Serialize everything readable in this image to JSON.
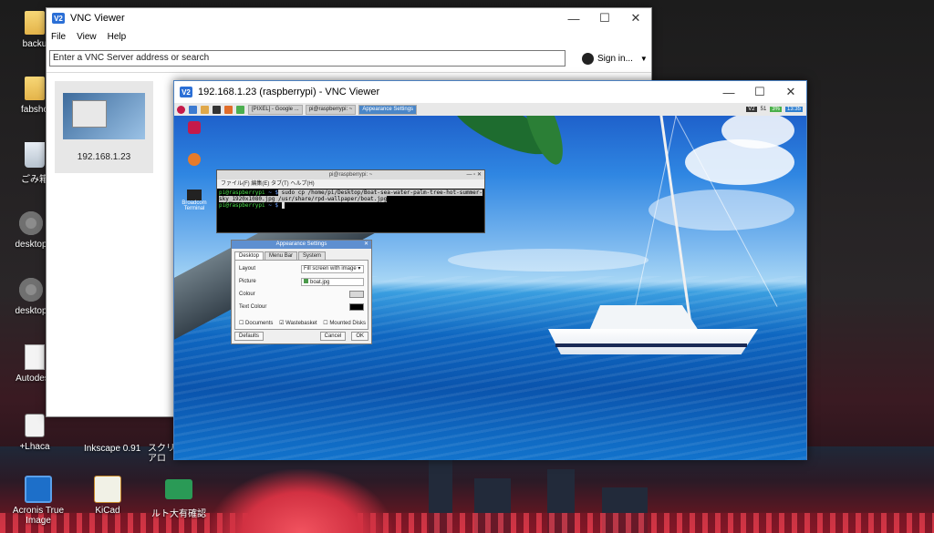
{
  "desktop": {
    "left_icons": [
      {
        "label": "backu",
        "icon": "folder-icon"
      },
      {
        "label": "fabsho",
        "icon": "folder-icon"
      },
      {
        "label": "ごみ箱",
        "icon": "recycle-bin-icon"
      },
      {
        "label": "desktop",
        "icon": "settings-icon"
      },
      {
        "label": "desktop",
        "icon": "settings-icon"
      },
      {
        "label": "Autodesk",
        "icon": "document-icon"
      },
      {
        "label": "+Lhaca",
        "icon": "archive-app-icon"
      }
    ],
    "bottom_icons": [
      {
        "label": "Inkscape 0.91"
      },
      {
        "label": "スクリ アロ"
      },
      {
        "label": "Acronis True Image",
        "icon": "acronis-icon"
      },
      {
        "label": "KiCad",
        "icon": "kicad-icon"
      },
      {
        "label": "ルト大有確認",
        "icon": "green-app-icon"
      }
    ]
  },
  "vnc_main": {
    "title": "VNC Viewer",
    "logo": "V2",
    "menu": [
      "File",
      "View",
      "Help"
    ],
    "search_placeholder": "Enter a VNC Server address or search",
    "sign_in": "Sign in...",
    "tile_label": "192.168.1.23",
    "controls": {
      "minimize": "—",
      "maximize": "☐",
      "close": "✕"
    }
  },
  "vnc_session": {
    "title": "192.168.1.23 (raspberrypi) - VNC Viewer",
    "logo": "V2",
    "controls": {
      "minimize": "—",
      "maximize": "☐",
      "close": "✕"
    }
  },
  "rpi": {
    "panel_tasks": [
      "[PIXEL] - Google ...",
      "pi@raspberrypi: ~",
      "Appearance Settings"
    ],
    "tray": {
      "vnc": "V2",
      "volume": "51",
      "battery": "3%",
      "clock": "13:35"
    },
    "desk_icons": [
      "",
      "Broadcom Terminal",
      ""
    ],
    "terminal": {
      "title": "pi@raspberrypi: ~",
      "menu": "ファイル(F)  編集(E)  タブ(T)  ヘルプ(H)",
      "line1_prompt": "pi@raspberrypi",
      "line1_path": "~ $",
      "line1_cmd": " sudo cp /home/pi/Desktop/Boat-sea-water-palm-tree-hot-summer-",
      "line2": "sky_1920x1080.jpg /usr/share/rpd-wallpaper/boat.jpg",
      "line3_prompt": "pi@raspberrypi",
      "line3_path": "~ $"
    },
    "appearance": {
      "title": "Appearance Settings",
      "tabs": [
        "Desktop",
        "Menu Bar",
        "System"
      ],
      "layout_label": "Layout",
      "layout_value": "Fill screen with image",
      "picture_label": "Picture",
      "picture_value": "boat.jpg",
      "colour_label": "Colour",
      "text_colour_label": "Text Colour",
      "checks": [
        "Documents",
        "Wastebasket",
        "Mounted Disks"
      ],
      "defaults": "Defaults",
      "cancel": "Cancel",
      "ok": "OK"
    }
  }
}
